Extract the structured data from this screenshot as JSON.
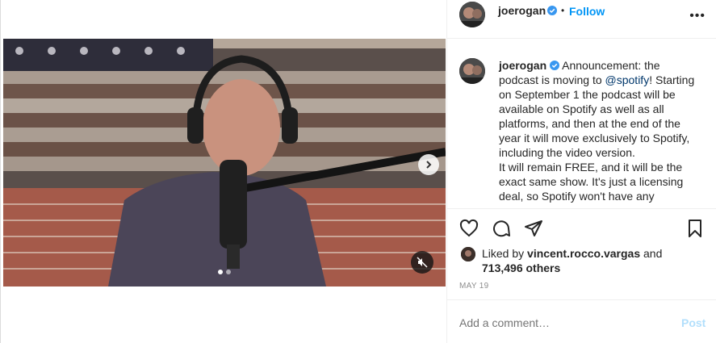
{
  "post": {
    "media": {
      "carousel_dots": 2,
      "active_dot": 0
    },
    "header": {
      "username": "joerogan",
      "separator": "•",
      "follow_label": "Follow",
      "more_icon": "more-horizontal-icon"
    },
    "caption": {
      "username": "joerogan",
      "text_before_mention": "Announcement: the podcast is moving to ",
      "mention": "@spotify",
      "text_after_mention": "! Starting on September 1 the podcast will be available on Spotify as well as all platforms, and then at the end of the year it will move exclusively to Spotify, including the video version.\nIt will remain FREE, and it will be the exact same show. It's just a licensing deal, so Spotify won't have any"
    },
    "actions": {
      "like_icon": "heart-icon",
      "comment_icon": "comment-icon",
      "share_icon": "paper-plane-icon",
      "save_icon": "bookmark-icon"
    },
    "likes": {
      "prefix": "Liked by ",
      "user": "vincent.rocco.vargas",
      "conjunction": " and",
      "count": "713,496 others"
    },
    "date": "MAY 19",
    "comment": {
      "placeholder": "Add a comment…",
      "post_label": "Post"
    }
  }
}
